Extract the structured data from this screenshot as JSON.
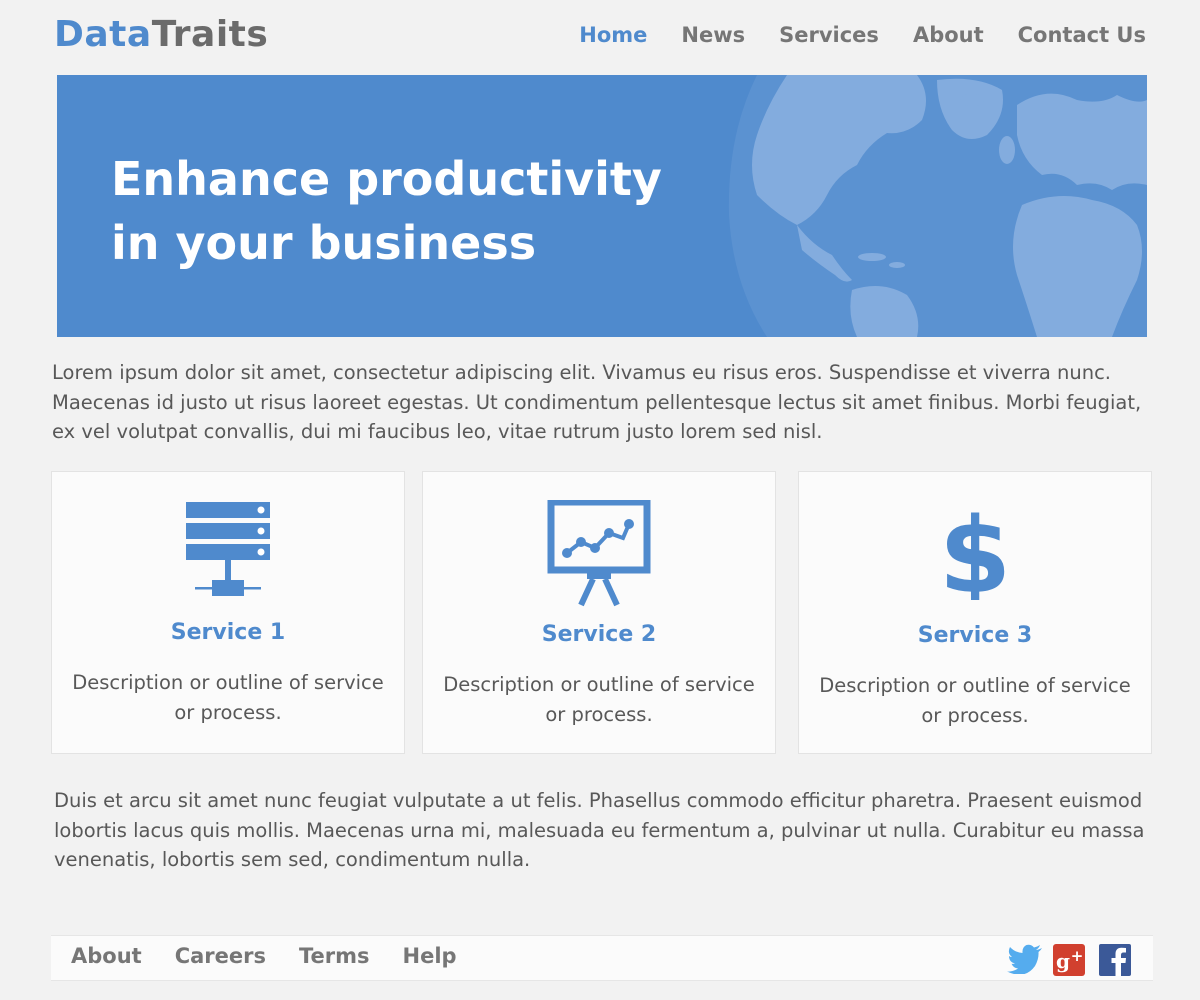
{
  "header": {
    "logo_part1": "Data",
    "logo_part2": "Traits",
    "nav": [
      "Home",
      "News",
      "Services",
      "About",
      "Contact Us"
    ],
    "active_nav": "Home"
  },
  "hero": {
    "line1": "Enhance productivity",
    "line2": "in your business"
  },
  "intro_text": "Lorem ipsum dolor sit amet, consectetur adipiscing elit. Vivamus eu risus eros. Suspendisse et viverra nunc. Maecenas id justo ut risus laoreet egestas. Ut condimentum pellentesque lectus sit amet finibus. Morbi feugiat, ex vel volutpat convallis, dui mi faucibus leo, vitae rutrum justo lorem sed nisl.",
  "services": [
    {
      "title": "Service 1",
      "description": "Description or outline of service or process.",
      "icon": "server-icon"
    },
    {
      "title": "Service 2",
      "description": "Description or outline of service or process.",
      "icon": "presentation-chart-icon"
    },
    {
      "title": "Service 3",
      "description": "Description or outline of service or process.",
      "icon": "dollar-icon"
    }
  ],
  "outro_text": "Duis et arcu sit amet nunc feugiat vulputate a ut felis. Phasellus commodo efficitur pharetra. Praesent euismod lobortis lacus quis mollis. Maecenas urna mi, malesuada eu fermentum a, pulvinar ut nulla. Curabitur eu massa venenatis, lobortis sem sed, condimentum nulla.",
  "footer": {
    "links": [
      "About",
      "Careers",
      "Terms",
      "Help"
    ],
    "social": [
      "twitter-icon",
      "google-plus-icon",
      "facebook-icon"
    ]
  },
  "colors": {
    "accent": "#4f8acd",
    "background": "#f2f2f2",
    "card": "#fbfbfb",
    "text": "#585858"
  }
}
